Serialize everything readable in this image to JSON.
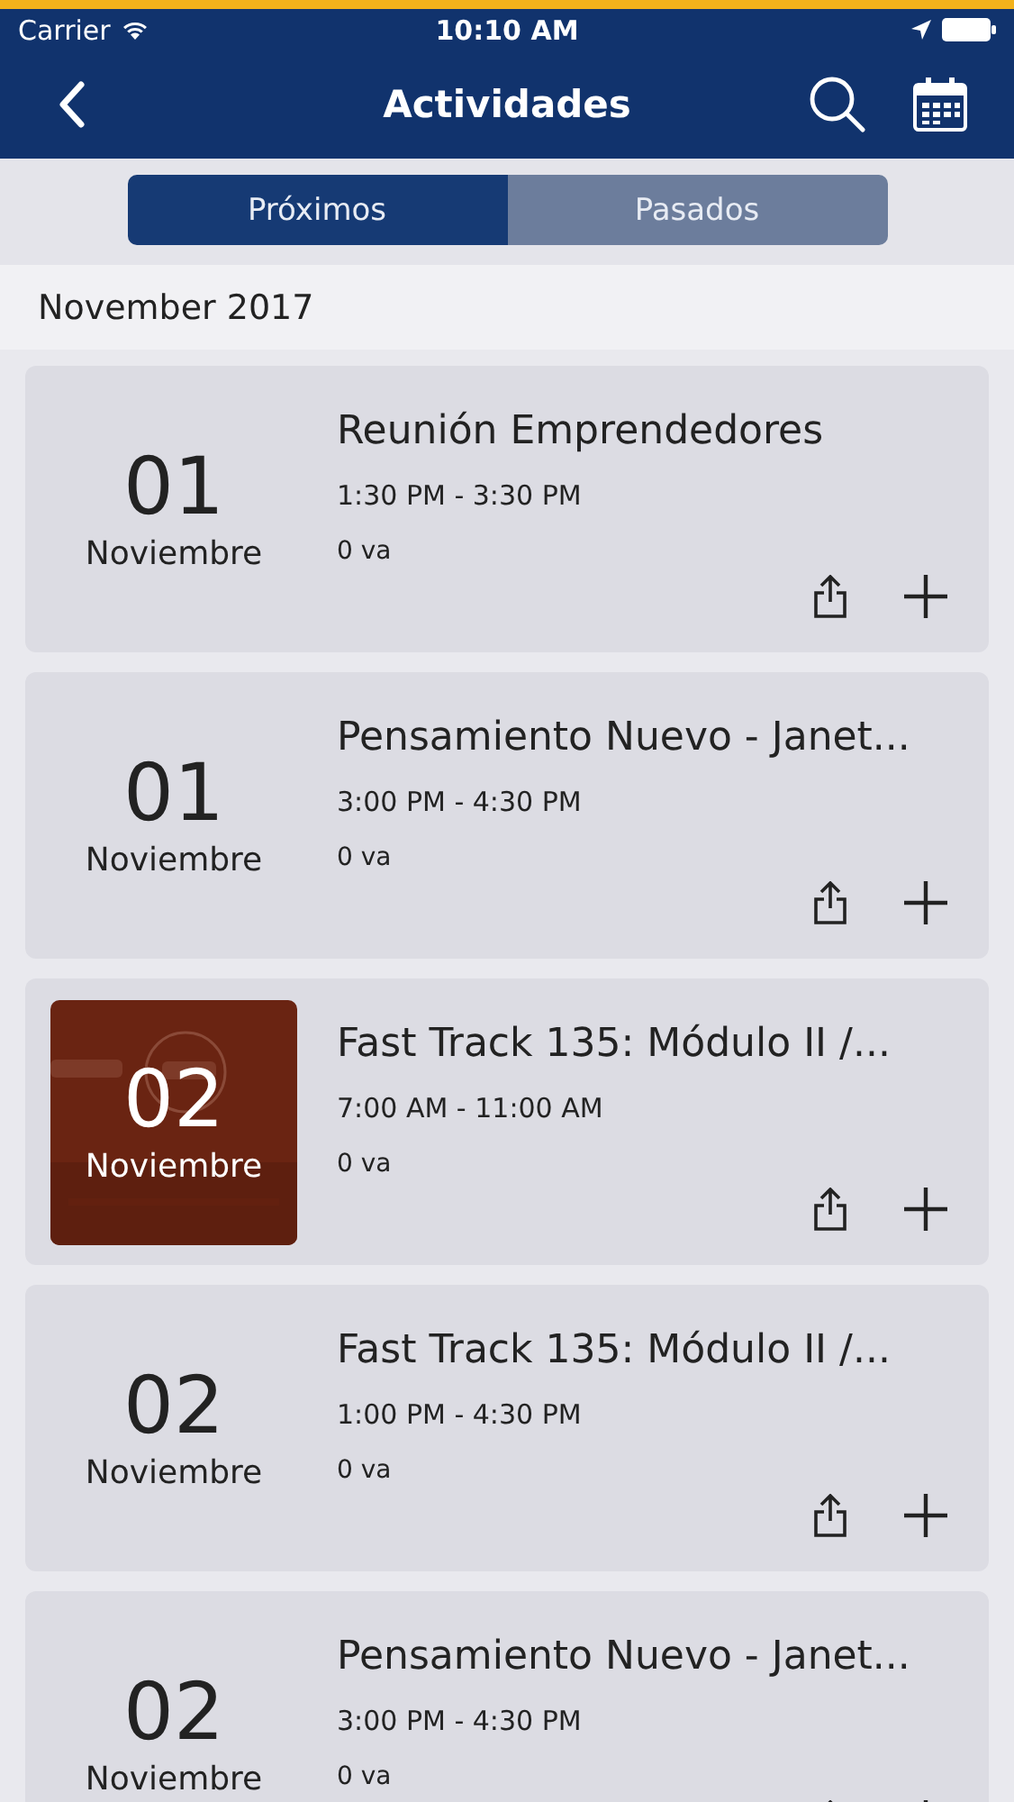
{
  "status_bar": {
    "carrier": "Carrier",
    "time": "10:10 AM"
  },
  "nav": {
    "title": "Actividades"
  },
  "tabs": [
    {
      "label": "Próximos",
      "selected": true
    },
    {
      "label": "Pasados",
      "selected": false
    }
  ],
  "section": "November 2017",
  "events": [
    {
      "day": "01",
      "month": "Noviembre",
      "title": "Reunión Emprendedores",
      "time": "1:30 PM - 3:30 PM",
      "attendees": "0 va",
      "kind": "plain"
    },
    {
      "day": "01",
      "month": "Noviembre",
      "title": "Pensamiento Nuevo - Janet...",
      "time": "3:00 PM - 4:30 PM",
      "attendees": "0 va",
      "kind": "plain"
    },
    {
      "day": "02",
      "month": "Noviembre",
      "title": "Fast Track 135: Módulo II /...",
      "time": "7:00 AM - 11:00 AM",
      "attendees": "0 va",
      "kind": "picture"
    },
    {
      "day": "02",
      "month": "Noviembre",
      "title": "Fast Track 135: Módulo II /...",
      "time": "1:00 PM - 4:30 PM",
      "attendees": "0 va",
      "kind": "plain"
    },
    {
      "day": "02",
      "month": "Noviembre",
      "title": "Pensamiento Nuevo - Janet...",
      "time": "3:00 PM - 4:30 PM",
      "attendees": "0 va",
      "kind": "plain"
    }
  ]
}
